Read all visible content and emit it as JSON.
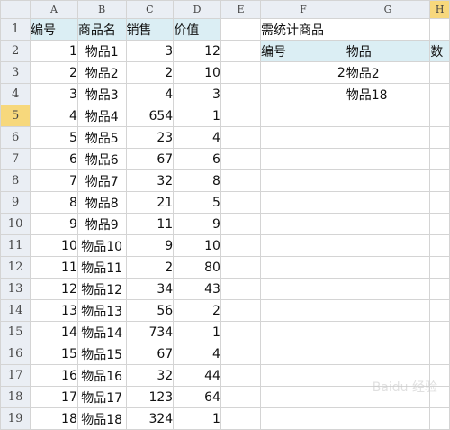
{
  "columns": [
    "A",
    "B",
    "C",
    "D",
    "E",
    "F",
    "G",
    "H"
  ],
  "active_column": "H",
  "active_row": 5,
  "rows": [
    {
      "n": "1",
      "A": "编号",
      "B": "商品名",
      "C": "销售",
      "D": "价值",
      "F": "需统计商品",
      "G": "",
      "H": ""
    },
    {
      "n": "2",
      "A": "1",
      "B": "物品1",
      "C": "3",
      "D": "12",
      "F": "编号",
      "G": "物品",
      "H": "数"
    },
    {
      "n": "3",
      "A": "2",
      "B": "物品2",
      "C": "2",
      "D": "10",
      "F": "2",
      "G": "物品2",
      "H": ""
    },
    {
      "n": "4",
      "A": "3",
      "B": "物品3",
      "C": "4",
      "D": "3",
      "F": "",
      "G": "物品18",
      "H": ""
    },
    {
      "n": "5",
      "A": "4",
      "B": "物品4",
      "C": "654",
      "D": "1"
    },
    {
      "n": "6",
      "A": "5",
      "B": "物品5",
      "C": "23",
      "D": "4"
    },
    {
      "n": "7",
      "A": "6",
      "B": "物品6",
      "C": "67",
      "D": "6"
    },
    {
      "n": "8",
      "A": "7",
      "B": "物品7",
      "C": "32",
      "D": "8"
    },
    {
      "n": "9",
      "A": "8",
      "B": "物品8",
      "C": "21",
      "D": "5"
    },
    {
      "n": "10",
      "A": "9",
      "B": "物品9",
      "C": "11",
      "D": "9"
    },
    {
      "n": "11",
      "A": "10",
      "B": "物品10",
      "C": "9",
      "D": "10"
    },
    {
      "n": "12",
      "A": "11",
      "B": "物品11",
      "C": "2",
      "D": "80"
    },
    {
      "n": "13",
      "A": "12",
      "B": "物品12",
      "C": "34",
      "D": "43"
    },
    {
      "n": "14",
      "A": "13",
      "B": "物品13",
      "C": "56",
      "D": "2"
    },
    {
      "n": "15",
      "A": "14",
      "B": "物品14",
      "C": "734",
      "D": "1"
    },
    {
      "n": "16",
      "A": "15",
      "B": "物品15",
      "C": "67",
      "D": "4"
    },
    {
      "n": "17",
      "A": "16",
      "B": "物品16",
      "C": "32",
      "D": "44"
    },
    {
      "n": "18",
      "A": "17",
      "B": "物品17",
      "C": "123",
      "D": "64"
    },
    {
      "n": "19",
      "A": "18",
      "B": "物品18",
      "C": "324",
      "D": "1"
    }
  ],
  "watermark": "Baidu 经验"
}
